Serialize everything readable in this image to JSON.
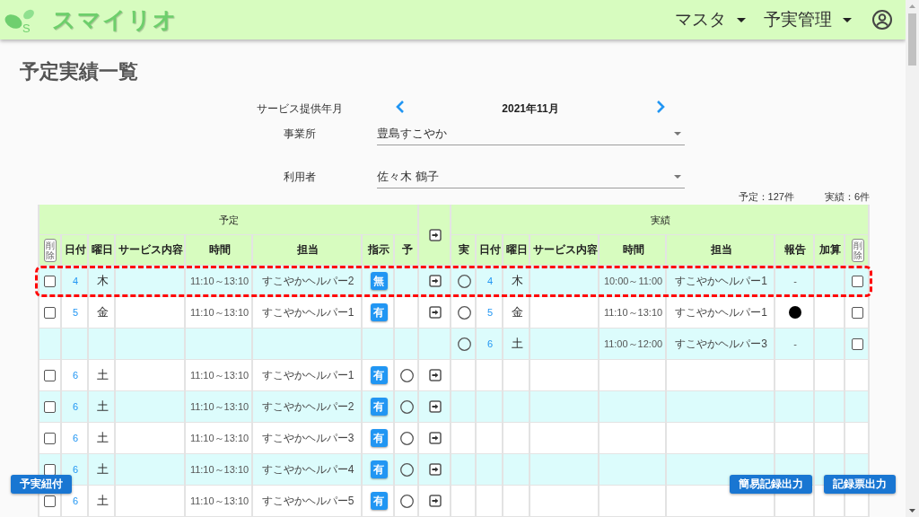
{
  "header": {
    "logo": {
      "mark": "S",
      "name": "スマイリオ"
    },
    "menus": [
      {
        "label": "マスタ"
      },
      {
        "label": "予実管理"
      }
    ]
  },
  "title": "予定実績一覧",
  "filters": {
    "month": {
      "label": "サービス提供年月",
      "value": "2021年11月"
    },
    "fields": [
      {
        "label": "事業所",
        "value": "豊島すこやか"
      },
      {
        "label": "利用者",
        "value": "佐々木 鶴子"
      }
    ]
  },
  "counts": [
    "予定：127件",
    "実績：6件"
  ],
  "table": {
    "groups": [
      "予定",
      "実績"
    ],
    "plan_columns": [
      {
        "kind": "delete",
        "label": "削除"
      },
      {
        "kind": "text",
        "label": "日付"
      },
      {
        "kind": "text",
        "label": "曜日"
      },
      {
        "kind": "text",
        "label": "サービス内容"
      },
      {
        "kind": "text",
        "label": "時間"
      },
      {
        "kind": "text",
        "label": "担当"
      },
      {
        "kind": "text",
        "label": "指示"
      },
      {
        "kind": "text",
        "label": "予"
      }
    ],
    "actual_columns": [
      {
        "kind": "text",
        "label": "実"
      },
      {
        "kind": "text",
        "label": "日付"
      },
      {
        "kind": "text",
        "label": "曜日"
      },
      {
        "kind": "text",
        "label": "サービス内容"
      },
      {
        "kind": "text",
        "label": "時間"
      },
      {
        "kind": "text",
        "label": "担当"
      },
      {
        "kind": "text",
        "label": "報告"
      },
      {
        "kind": "text",
        "label": "加算"
      },
      {
        "kind": "delete",
        "label": "削除"
      }
    ],
    "rows": [
      {
        "highlighted": true,
        "plan": {
          "checked": false,
          "date": "4",
          "weekday": "木",
          "time": "11:10～13:10",
          "staff": "すこやかヘルパー2",
          "instruction": "無",
          "circle": false
        },
        "transfer": true,
        "actual": {
          "circle": true,
          "date": "4",
          "weekday": "木",
          "time": "10:00～11:00",
          "staff": "すこやかヘルパー1",
          "report": {
            "kind": "text",
            "text": "-"
          },
          "checked": false
        }
      },
      {
        "highlighted": false,
        "plan": {
          "checked": false,
          "date": "5",
          "weekday": "金",
          "time": "11:10～13:10",
          "staff": "すこやかヘルパー1",
          "instruction": "有",
          "circle": false
        },
        "transfer": true,
        "actual": {
          "circle": true,
          "date": "5",
          "weekday": "金",
          "time": "11:10～13:10",
          "staff": "すこやかヘルパー1",
          "report": {
            "kind": "dot"
          },
          "checked": false
        }
      },
      {
        "highlighted": false,
        "transfer": false,
        "actual": {
          "circle": true,
          "date": "6",
          "weekday": "土",
          "time": "11:00～12:00",
          "staff": "すこやかヘルパー3",
          "report": {
            "kind": "text",
            "text": "-"
          },
          "checked": false
        }
      },
      {
        "highlighted": false,
        "plan": {
          "checked": false,
          "date": "6",
          "weekday": "土",
          "time": "11:10～13:10",
          "staff": "すこやかヘルパー1",
          "instruction": "有",
          "circle": true
        },
        "transfer": true
      },
      {
        "highlighted": false,
        "plan": {
          "checked": false,
          "date": "6",
          "weekday": "土",
          "time": "11:10～13:10",
          "staff": "すこやかヘルパー2",
          "instruction": "有",
          "circle": true
        },
        "transfer": true
      },
      {
        "highlighted": false,
        "plan": {
          "checked": false,
          "date": "6",
          "weekday": "土",
          "time": "11:10～13:10",
          "staff": "すこやかヘルパー3",
          "instruction": "有",
          "circle": true
        },
        "transfer": true
      },
      {
        "highlighted": false,
        "plan": {
          "checked": false,
          "date": "6",
          "weekday": "土",
          "time": "11:10～13:10",
          "staff": "すこやかヘルパー4",
          "instruction": "有",
          "circle": true
        },
        "transfer": true
      },
      {
        "highlighted": false,
        "plan": {
          "checked": false,
          "date": "6",
          "weekday": "土",
          "time": "11:10～13:10",
          "staff": "すこやかヘルパー5",
          "instruction": "有",
          "circle": true
        },
        "transfer": true
      }
    ]
  },
  "buttons": [
    "予実紐付",
    "簡易記録出力",
    "記録票出力"
  ]
}
